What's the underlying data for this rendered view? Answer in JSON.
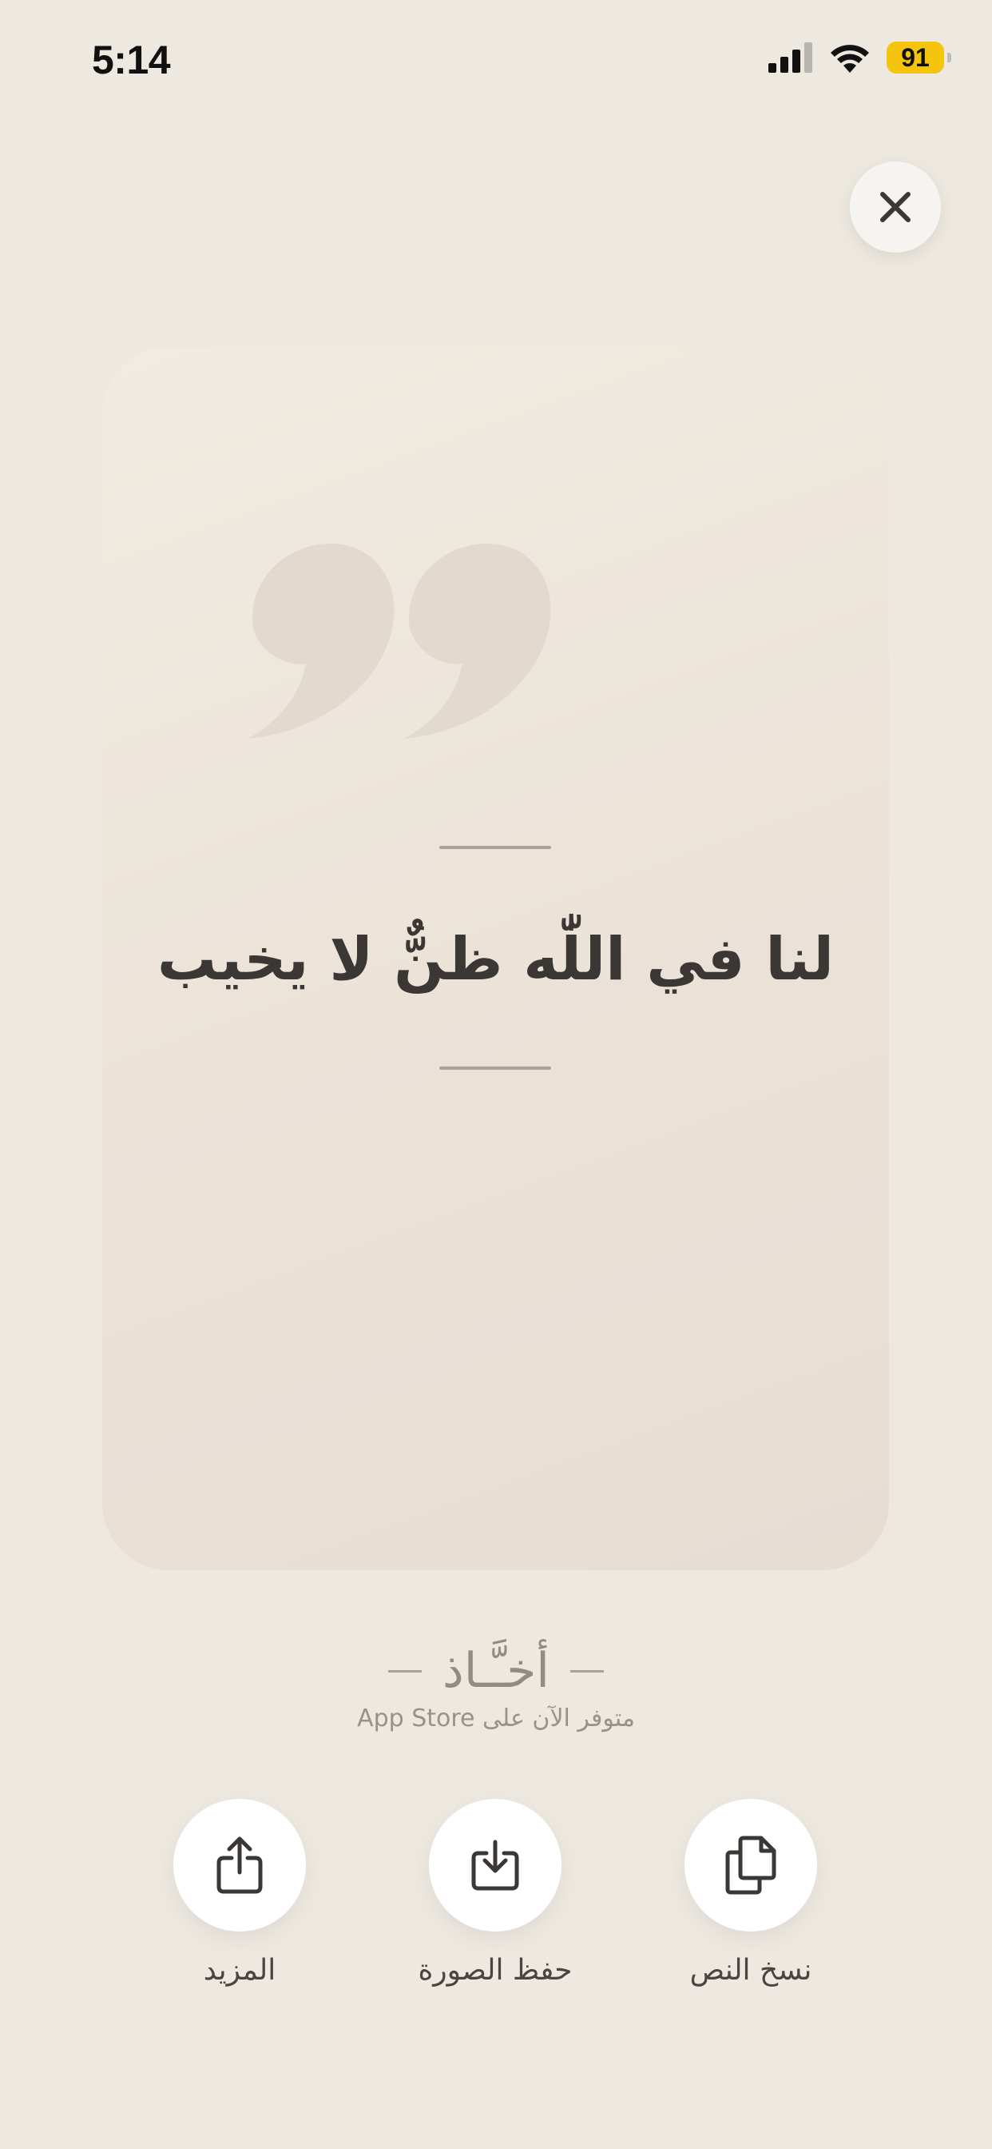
{
  "status_bar": {
    "time": "5:14",
    "battery": "91",
    "icons": [
      "signal-icon",
      "wifi-icon",
      "battery-icon"
    ]
  },
  "close": {
    "icon": "close-icon"
  },
  "quote": {
    "text": "لنا في اللّٰه ظنٌّ لا يخيب",
    "decoration_icon": "quote-mark-icon"
  },
  "branding": {
    "name": "أخـَّـاذ",
    "availability": "متوفر الآن على App Store"
  },
  "actions": {
    "more": {
      "label": "المزيد",
      "icon": "share-icon"
    },
    "save_image": {
      "label": "حفظ الصورة",
      "icon": "download-icon"
    },
    "copy_text": {
      "label": "نسخ النص",
      "icon": "copy-icon"
    }
  },
  "colors": {
    "background": "#ede8e0",
    "card": "#ebe3d8",
    "text": "#3b3734",
    "battery": "#f5c40e"
  }
}
